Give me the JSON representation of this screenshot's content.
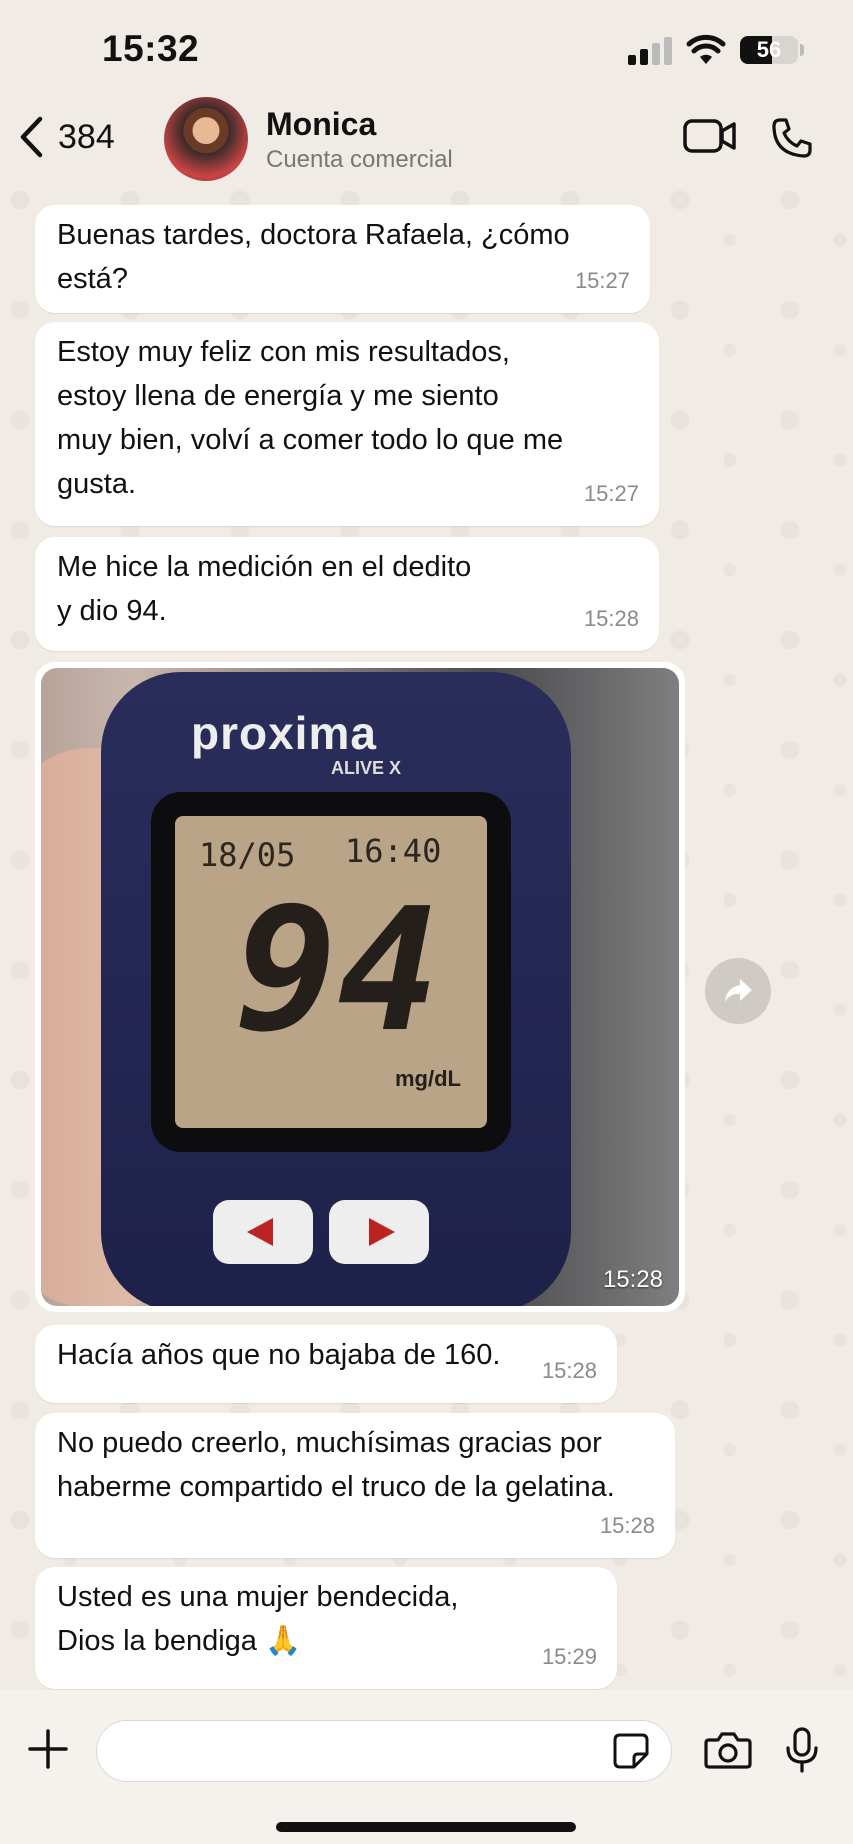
{
  "status_bar": {
    "time": "15:32",
    "battery": "56",
    "battery_level": 0.56
  },
  "header": {
    "back_count": "384",
    "contact_name": "Monica",
    "contact_subtitle": "Cuenta comercial"
  },
  "messages": [
    {
      "text": "Buenas tardes, doctora Rafaela, ¿cómo está?",
      "time": "15:27"
    },
    {
      "text": "Estoy muy feliz con mis resultados,\nestoy llena de energía y me siento\nmuy bien, volví a comer todo lo que me\ngusta.",
      "time": "15:27"
    },
    {
      "text": "Me hice la medición en el dedito\ny dio 94.",
      "time": "15:28"
    },
    {
      "text": "Hacía años que no bajaba de 160.",
      "time": "15:28"
    },
    {
      "text": "No puedo creerlo, muchísimas gracias por\nhaberme compartido el truco de la gelatina.",
      "time": "15:28"
    },
    {
      "text": "Usted es una mujer bendecida,\nDios la bendiga 🙏",
      "time": "15:29"
    }
  ],
  "photo": {
    "time": "15:28",
    "brand": "proxima",
    "model": "ALIVE X",
    "date": "18/05",
    "clock": "16:40",
    "reading": "94",
    "unit": "mg/dL"
  },
  "input": {
    "placeholder": ""
  },
  "colors": {
    "background": "#f0ebe4",
    "bubble": "#ffffff",
    "timestamp": "#8a8a8a"
  }
}
